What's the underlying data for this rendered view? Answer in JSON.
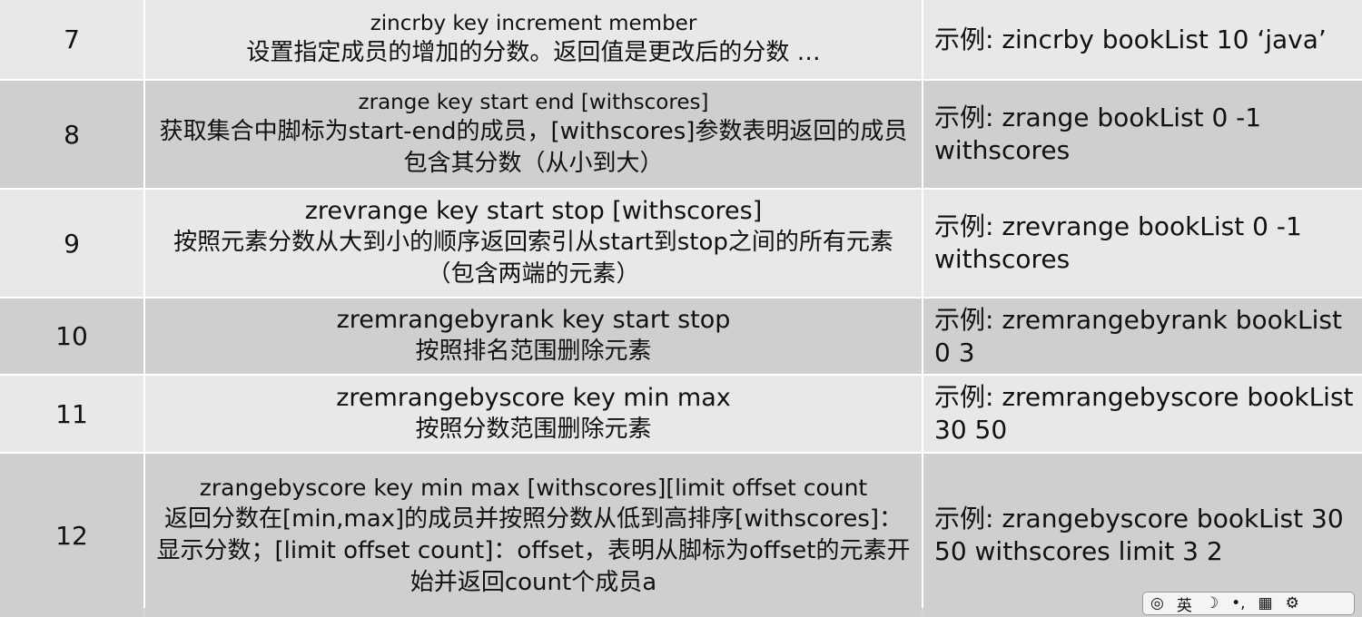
{
  "rows": [
    {
      "num": "7",
      "cmd": "zincrby key increment member",
      "desc": "设置指定成员的增加的分数。返回值是更改后的分数 …",
      "example": [
        "示例: zincrby bookList 10 ‘java’"
      ]
    },
    {
      "num": "8",
      "cmd": "zrange key start end [withscores]",
      "desc": "获取集合中脚标为start-end的成员，[withscores]参数表明返回的成员包含其分数（从小到大）",
      "example": [
        "示例: zrange bookList 0 -1",
        "withscores"
      ]
    },
    {
      "num": "9",
      "cmd": "zrevrange key start stop [withscores]",
      "desc": "按照元素分数从大到小的顺序返回索引从start到stop之间的所有元素（包含两端的元素）",
      "example": [
        "示例: zrevrange bookList 0 -1",
        "withscores"
      ]
    },
    {
      "num": "10",
      "cmd": "zremrangebyrank key start stop",
      "desc": "按照排名范围删除元素",
      "example": [
        "示例: zremrangebyrank bookList",
        "0 3"
      ]
    },
    {
      "num": "11",
      "cmd": "zremrangebyscore key min max",
      "desc": "按照分数范围删除元素",
      "example": [
        "示例: zremrangebyscore bookList",
        "30 50"
      ]
    },
    {
      "num": "12",
      "cmd": "zrangebyscore key min max [withscores][limit offset count",
      "desc": "返回分数在[min,max]的成员并按照分数从低到高排序[withscores]：显示分数；[limit offset count]：offset，表明从脚标为offset的元素开始并返回count个成员a",
      "example": [
        "示例: zrangebyscore bookList 30",
        "50 withscores limit 3 2"
      ]
    }
  ],
  "ime_toolbar": {
    "icons": [
      "ime-logo-icon",
      "english-mode-icon",
      "moon-icon",
      "punctuation-icon",
      "keyboard-icon",
      "gear-icon"
    ],
    "glyphs": [
      "◎",
      "英",
      "☽",
      "•,",
      "▦",
      "⚙"
    ]
  }
}
